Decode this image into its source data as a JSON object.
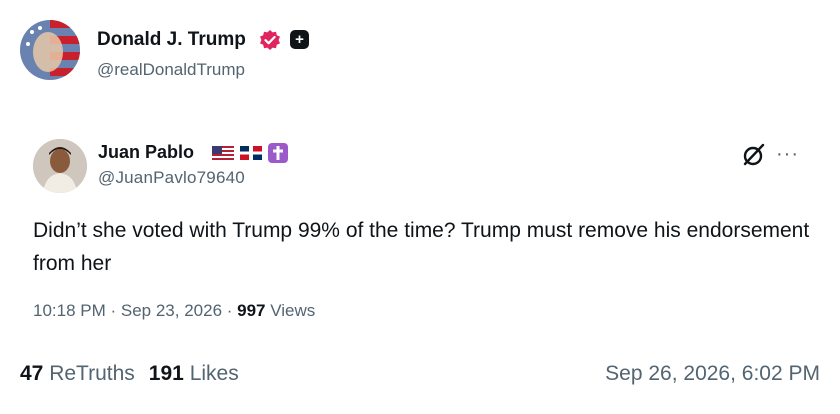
{
  "post": {
    "author_name": "Donald J. Trump",
    "author_handle": "@realDonaldTrump",
    "verified_icon": "verified-badge-icon",
    "plus_badge": "+",
    "retruths_count": "47",
    "retruths_label": "ReTruths",
    "likes_count": "191",
    "likes_label": "Likes",
    "timestamp": "Sep 26, 2026, 6:02 PM"
  },
  "quoted": {
    "author_name": "Juan Pablo",
    "author_handle": "@JuanPavlo79640",
    "text": "Didn’t she voted with Trump 99% of the time?  Trump must remove his endorsement from her",
    "time": "10:18 PM · Sep 23, 2026 · ",
    "views_count": "997",
    "views_label": " Views",
    "more_label": "···"
  },
  "colors": {
    "text": "#0f1419",
    "secondary": "#536471",
    "verified": "#e0245e"
  }
}
